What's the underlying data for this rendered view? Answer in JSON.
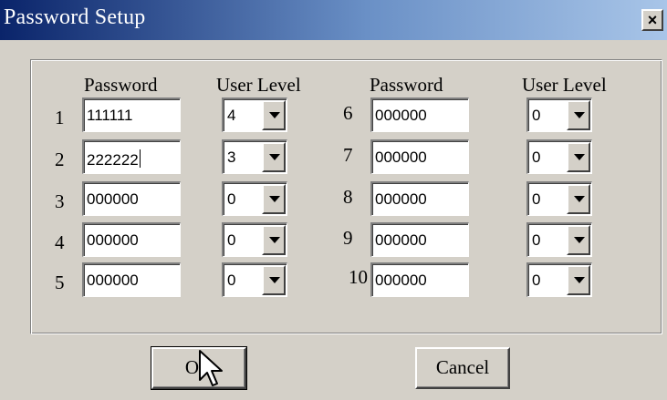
{
  "window": {
    "title": "Password Setup",
    "close_label": "×"
  },
  "headers": {
    "left_password": "Password",
    "left_level": "User Level",
    "right_password": "Password",
    "right_level": "User Level"
  },
  "rows": [
    {
      "num": "1",
      "password": "111111",
      "level": "4"
    },
    {
      "num": "2",
      "password": "222222",
      "level": "3"
    },
    {
      "num": "3",
      "password": "000000",
      "level": "0"
    },
    {
      "num": "4",
      "password": "000000",
      "level": "0"
    },
    {
      "num": "5",
      "password": "000000",
      "level": "0"
    },
    {
      "num": "6",
      "password": "000000",
      "level": "0"
    },
    {
      "num": "7",
      "password": "000000",
      "level": "0"
    },
    {
      "num": "8",
      "password": "000000",
      "level": "0"
    },
    {
      "num": "9",
      "password": "000000",
      "level": "0"
    },
    {
      "num": "10",
      "password": "000000",
      "level": "0"
    }
  ],
  "buttons": {
    "ok": "OK",
    "cancel": "Cancel"
  },
  "icons": {
    "close": "close-icon",
    "dropdown": "chevron-down-icon",
    "cursor": "mouse-pointer-icon"
  },
  "colors": {
    "titlebar_start": "#0a246a",
    "titlebar_end": "#a8c5e8",
    "dialog_bg": "#d4d0c8"
  }
}
